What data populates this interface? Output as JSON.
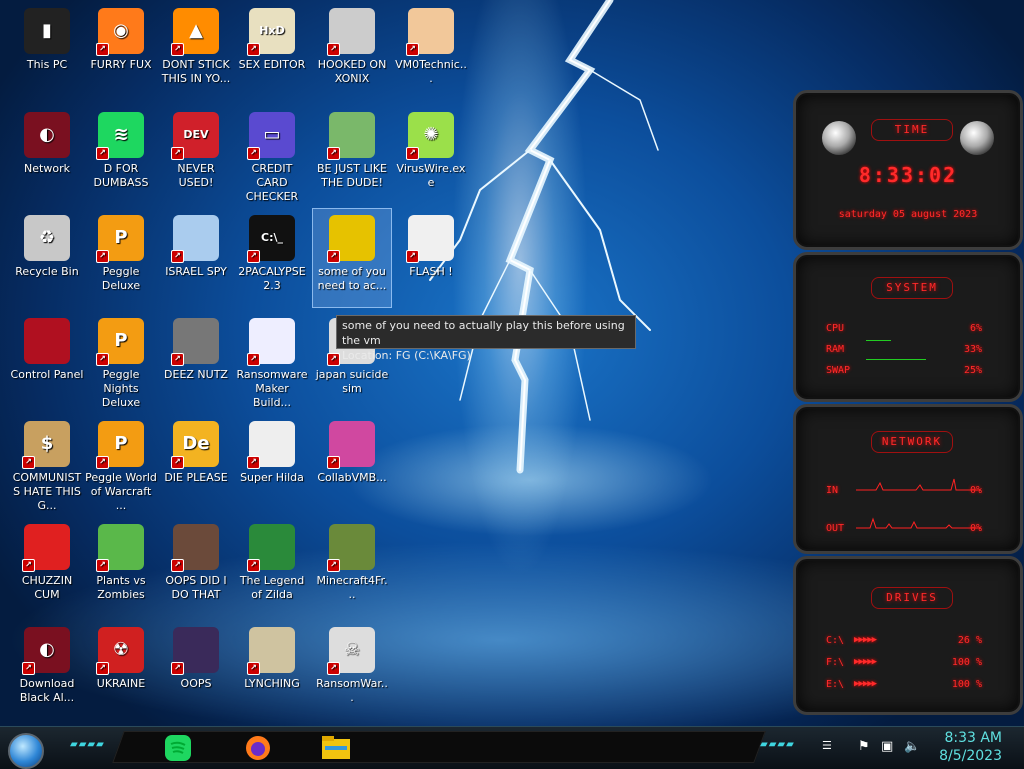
{
  "desktop_icons": [
    {
      "label": "This PC",
      "icon": "computer-icon"
    },
    {
      "label": "FURRY FUX",
      "icon": "firefox-icon"
    },
    {
      "label": "DONT STICK THIS IN YO...",
      "icon": "vlc-cone-icon"
    },
    {
      "label": "SEX EDITOR",
      "icon": "hxd-icon"
    },
    {
      "label": "HOOKED ON XONIX",
      "icon": "xonix-icon"
    },
    {
      "label": "VM0Technic...",
      "icon": "doctor-icon"
    },
    {
      "label": "Network",
      "icon": "alien-network-icon"
    },
    {
      "label": "D FOR DUMBASS",
      "icon": "spotify-icon"
    },
    {
      "label": "NEVER USED!",
      "icon": "devcpp-icon"
    },
    {
      "label": "CREDIT CARD CHECKER",
      "icon": "credit-card-icon"
    },
    {
      "label": "BE JUST LIKE THE DUDE!",
      "icon": "gnome-icon"
    },
    {
      "label": "VirusWire.exe",
      "icon": "lime-icon"
    },
    {
      "label": "Recycle Bin",
      "icon": "recycle-bin-icon"
    },
    {
      "label": "Peggle Deluxe",
      "icon": "peggle-icon"
    },
    {
      "label": "ISRAEL SPY",
      "icon": "network-pc-icon"
    },
    {
      "label": "2PACALYPSE 2.3",
      "icon": "terminal-icon"
    },
    {
      "label": "some of you need to ac...",
      "icon": "dog-icon"
    },
    {
      "label": "FLASH !",
      "icon": "flash-icon"
    },
    {
      "label": "Control Panel",
      "icon": "control-panel-icon"
    },
    {
      "label": "Peggle Nights Deluxe",
      "icon": "peggle-nights-icon"
    },
    {
      "label": "DEEZ NUTZ",
      "icon": "stacked-windows-icon"
    },
    {
      "label": "Ransomware Maker Build...",
      "icon": "window-app-icon"
    },
    {
      "label": "japan suicide sim",
      "icon": "game-icon"
    },
    {
      "label": "COMMUNISTS HATE THIS G...",
      "icon": "money-bag-icon"
    },
    {
      "label": "Peggle World of Warcraft ...",
      "icon": "peggle-wow-icon"
    },
    {
      "label": "DIE PLEASE",
      "icon": "de-icon"
    },
    {
      "label": "Super Hilda",
      "icon": "pixel-art-icon"
    },
    {
      "label": "CollabVMB...",
      "icon": "collabvm-icon"
    },
    {
      "label": "CHUZZIN CUM",
      "icon": "chuzzle-icon"
    },
    {
      "label": "Plants vs Zombies",
      "icon": "pvz-icon"
    },
    {
      "label": "OOPS DID I DO THAT",
      "icon": "portrait-icon"
    },
    {
      "label": "The Legend of Zilda",
      "icon": "zelda-icon"
    },
    {
      "label": "Minecraft4Fr...",
      "icon": "minecraft-icon"
    },
    {
      "label": "Download Black Al...",
      "icon": "alien-download-icon"
    },
    {
      "label": "UKRAINE",
      "icon": "radiation-icon"
    },
    {
      "label": "OOPS",
      "icon": "oops-icon"
    },
    {
      "label": "LYNCHING",
      "icon": "noose-icon"
    },
    {
      "label": "RansomWar...",
      "icon": "skull-icon"
    }
  ],
  "tooltip": {
    "line1": "some of you need to actually play this before using the vm",
    "line2": "Location: FG (C:\\KA\\FG)"
  },
  "gadget": {
    "time": {
      "header": "TIME",
      "clock": "8:33:02",
      "date": "saturday 05 august 2023"
    },
    "system": {
      "header": "SYSTEM",
      "rows": [
        {
          "key": "CPU",
          "value": "6%"
        },
        {
          "key": "RAM",
          "value": "33%"
        },
        {
          "key": "SWAP",
          "value": "25%"
        }
      ]
    },
    "network": {
      "header": "NETWORK",
      "rows": [
        {
          "key": "IN",
          "value": "0%"
        },
        {
          "key": "OUT",
          "value": "0%"
        }
      ]
    },
    "drives": {
      "header": "DRIVES",
      "rows": [
        {
          "key": "C:\\",
          "value": "26 %"
        },
        {
          "key": "F:\\",
          "value": "100 %"
        },
        {
          "key": "E:\\",
          "value": "100 %"
        }
      ]
    }
  },
  "taskbar": {
    "apps": [
      "spotify-icon",
      "firefox-icon",
      "file-explorer-icon"
    ],
    "time": "8:33 AM",
    "date": "8/5/2023"
  },
  "colors": {
    "accent_red": "#ff2a2a",
    "clock_cyan": "#5fe0e0",
    "desktop_blue": "#0c4e9c"
  }
}
